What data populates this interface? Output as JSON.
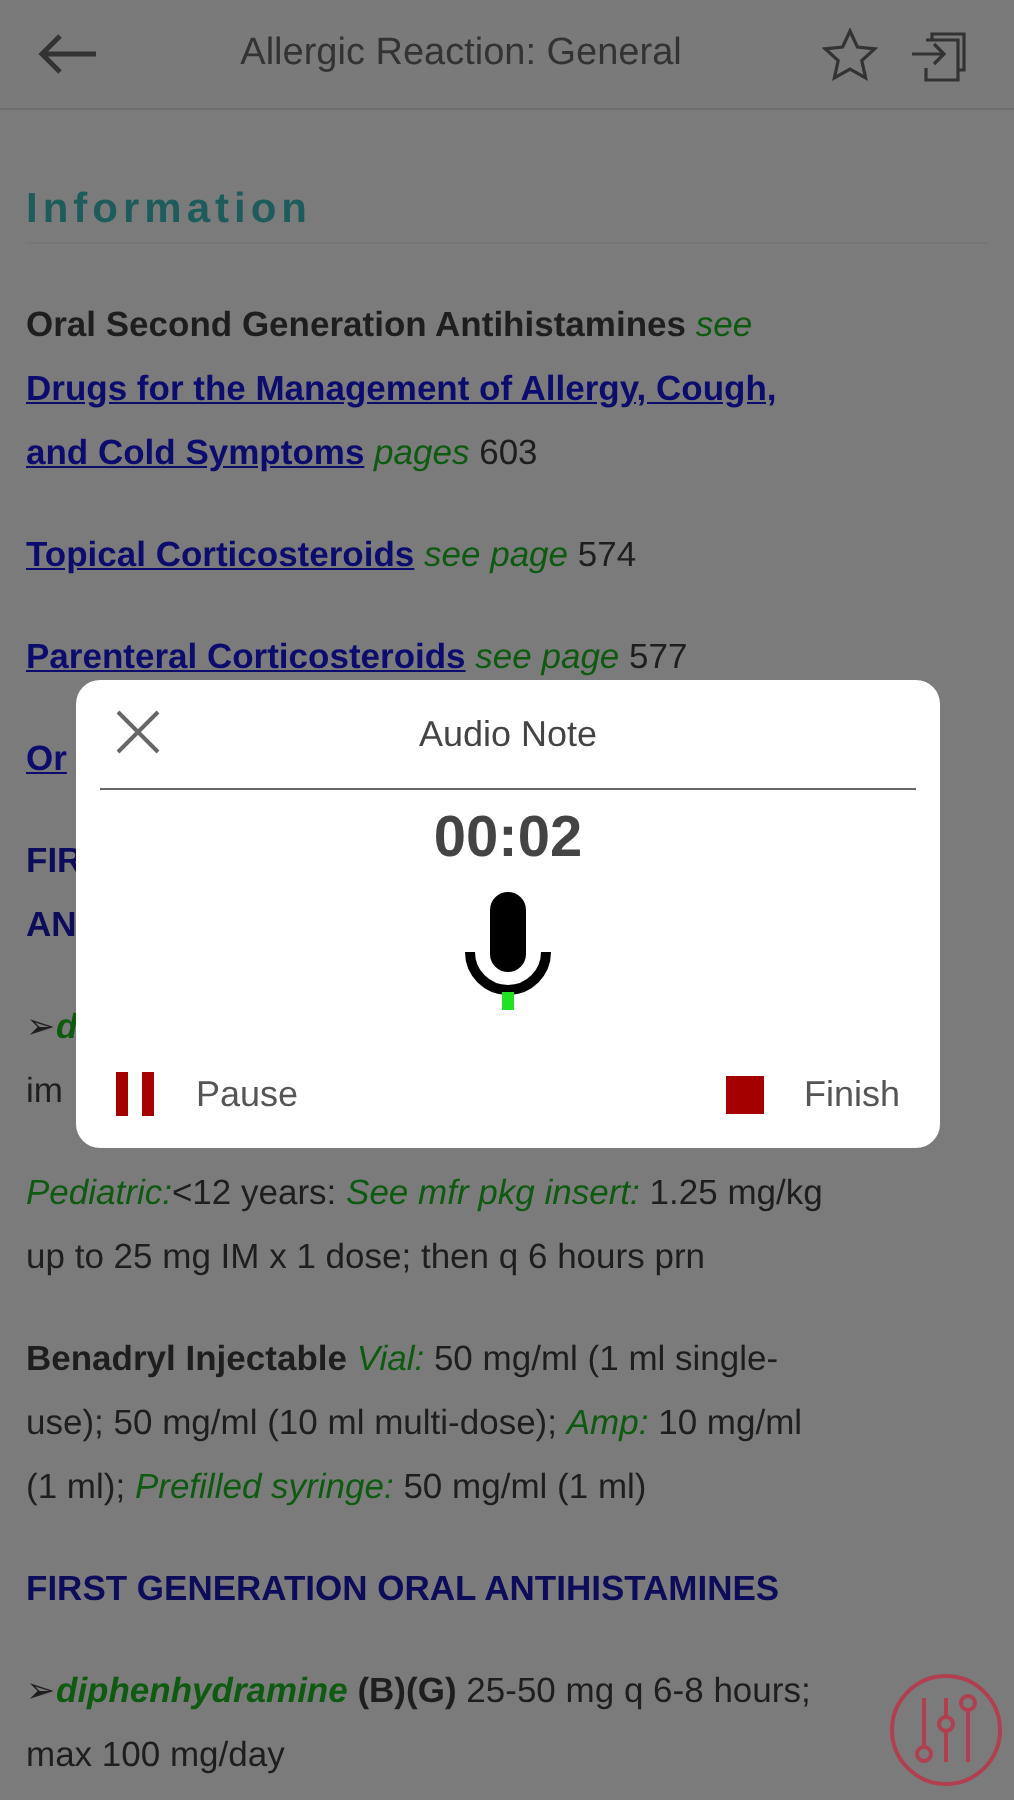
{
  "header": {
    "title": "Allergic Reaction: General"
  },
  "section_title": "Information",
  "paragraphs": [
    {
      "segments": [
        {
          "kind": "bold",
          "text": "Oral Second Generation Antihistamines"
        },
        {
          "kind": "green",
          "text": " see"
        },
        {
          "kind": "break"
        },
        {
          "kind": "link",
          "text": "Drugs for the Management of Allergy, Cough,"
        },
        {
          "kind": "break"
        },
        {
          "kind": "link",
          "text": "and Cold Symptoms"
        },
        {
          "kind": "green",
          "text": " pages"
        },
        {
          "kind": "plain",
          "text": " 603"
        }
      ]
    },
    {
      "segments": [
        {
          "kind": "link",
          "text": "Topical Corticosteroids"
        },
        {
          "kind": "green",
          "text": " see page"
        },
        {
          "kind": "plain",
          "text": " 574"
        }
      ]
    },
    {
      "segments": [
        {
          "kind": "link",
          "text": "Parenteral Corticosteroids"
        },
        {
          "kind": "green",
          "text": " see page"
        },
        {
          "kind": "plain",
          "text": " 577"
        }
      ]
    },
    {
      "segments": [
        {
          "kind": "link",
          "text": "Or"
        }
      ]
    },
    {
      "segments": [
        {
          "kind": "heading",
          "text": "FIR"
        },
        {
          "kind": "break"
        },
        {
          "kind": "heading",
          "text": "AN"
        }
      ]
    },
    {
      "segments": [
        {
          "kind": "plain",
          "text": "➢"
        },
        {
          "kind": "drug",
          "text": "d"
        },
        {
          "kind": "break"
        },
        {
          "kind": "plain",
          "text": "im"
        }
      ]
    },
    {
      "segments": [
        {
          "kind": "green",
          "text": "Pediatric:"
        },
        {
          "kind": "plain",
          "text": "<12 years: "
        },
        {
          "kind": "green",
          "text": "See mfr pkg insert:"
        },
        {
          "kind": "plain",
          "text": " 1.25 mg/kg"
        },
        {
          "kind": "break"
        },
        {
          "kind": "plain",
          "text": "up to 25 mg IM x 1 dose; then q 6 hours prn"
        }
      ]
    },
    {
      "segments": [
        {
          "kind": "bold",
          "text": "Benadryl Injectable"
        },
        {
          "kind": "green",
          "text": " Vial:"
        },
        {
          "kind": "plain",
          "text": " 50 mg/ml (1 ml single-"
        },
        {
          "kind": "break"
        },
        {
          "kind": "plain",
          "text": "use); 50 mg/ml (10 ml multi-dose); "
        },
        {
          "kind": "green",
          "text": "Amp:"
        },
        {
          "kind": "plain",
          "text": " 10 mg/ml"
        },
        {
          "kind": "break"
        },
        {
          "kind": "plain",
          "text": "(1 ml); "
        },
        {
          "kind": "green",
          "text": "Prefilled syringe:"
        },
        {
          "kind": "plain",
          "text": " 50 mg/ml (1 ml)"
        }
      ]
    },
    {
      "segments": [
        {
          "kind": "heading",
          "text": "FIRST GENERATION ORAL ANTIHISTAMINES"
        }
      ]
    },
    {
      "segments": [
        {
          "kind": "plain",
          "text": "➢"
        },
        {
          "kind": "drug",
          "text": "diphenhydramine"
        },
        {
          "kind": "bold",
          "text": " (B)(G)"
        },
        {
          "kind": "plain",
          "text": " 25-50 mg q 6-8 hours;"
        },
        {
          "kind": "break"
        },
        {
          "kind": "plain",
          "text": "max 100 mg/day"
        }
      ]
    }
  ],
  "dialog": {
    "title": "Audio Note",
    "time": "00:02",
    "actions": [
      {
        "kind": "pause",
        "label": "Pause"
      },
      {
        "kind": "stop",
        "label": "Finish"
      }
    ]
  }
}
